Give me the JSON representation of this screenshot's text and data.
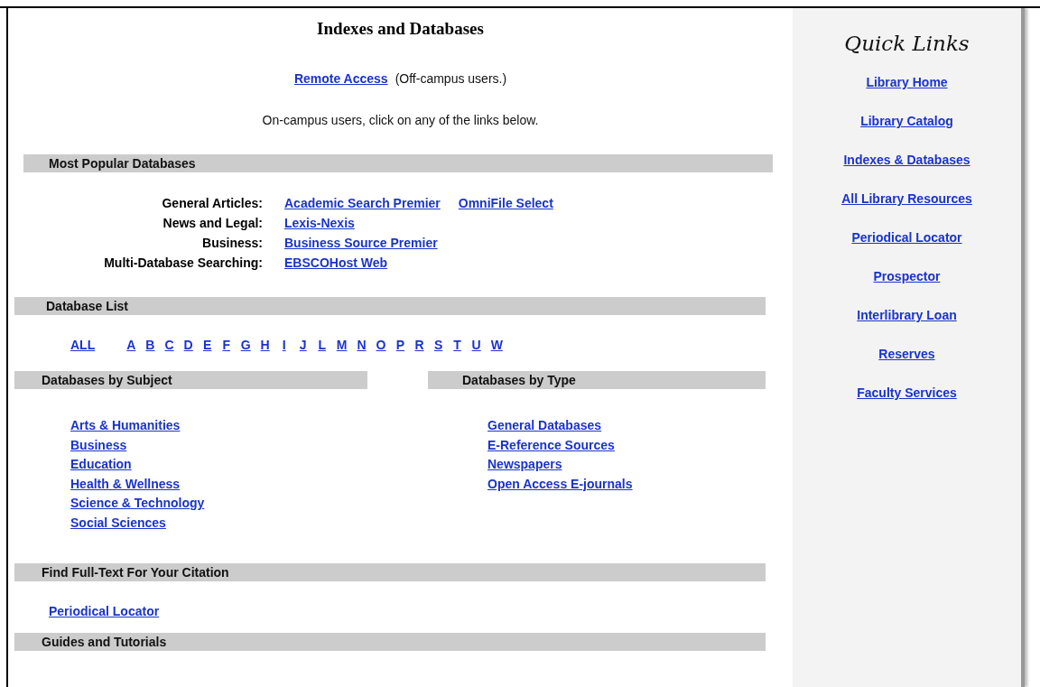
{
  "title": "Indexes and Databases",
  "remote": {
    "link": "Remote Access",
    "note": "(Off-campus users.)"
  },
  "intro": "On-campus users, click on any of the links below.",
  "popular": {
    "heading": "Most Popular Databases",
    "rows": [
      {
        "label": "General Articles:",
        "links": [
          "Academic Search Premier",
          "OmniFile Select"
        ]
      },
      {
        "label": "News and Legal:",
        "links": [
          "Lexis-Nexis"
        ]
      },
      {
        "label": "Business:",
        "links": [
          "Business Source Premier"
        ]
      },
      {
        "label": "Multi-Database Searching:",
        "links": [
          "EBSCOHost Web"
        ]
      }
    ]
  },
  "database_list": {
    "heading": "Database List",
    "all": "ALL",
    "letters": [
      "A",
      "B",
      "C",
      "D",
      "E",
      "F",
      "G",
      "H",
      "I",
      "J",
      "L",
      "M",
      "N",
      "O",
      "P",
      "R",
      "S",
      "T",
      "U",
      "W"
    ]
  },
  "by_subject": {
    "heading": "Databases by Subject",
    "links": [
      "Arts & Humanities",
      "Business",
      "Education",
      "Health & Wellness",
      "Science & Technology",
      "Social Sciences"
    ]
  },
  "by_type": {
    "heading": "Databases by Type",
    "links": [
      "General Databases",
      "E-Reference Sources",
      "Newspapers",
      "Open Access E-journals"
    ]
  },
  "full_text": {
    "heading": "Find Full-Text For Your Citation",
    "links": [
      "Periodical Locator"
    ]
  },
  "guides": {
    "heading": "Guides and Tutorials"
  },
  "sidebar": {
    "title": "Quick Links",
    "links": [
      "Library Home",
      "Library Catalog",
      "Indexes & Databases",
      "All Library Resources",
      "Periodical Locator",
      "Prospector",
      "Interlibrary Loan",
      "Reserves",
      "Faculty Services"
    ]
  }
}
